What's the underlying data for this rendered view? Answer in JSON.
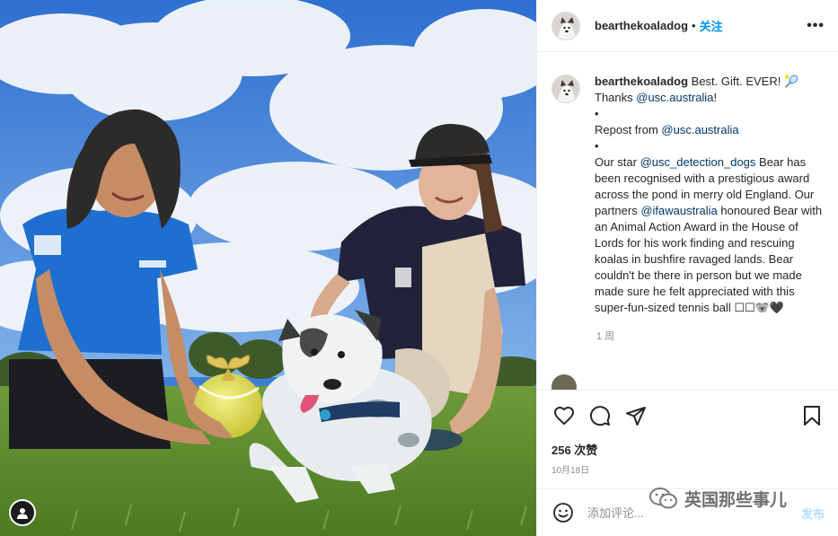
{
  "post": {
    "username": "bearthekoaladog",
    "follow_label": "关注",
    "header_separator": "•",
    "more_label": "•••",
    "caption": {
      "username": "bearthekoaladog",
      "line1": " Best. Gift. EVER! 🎾",
      "line2_prefix": "Thanks ",
      "line2_mention": "@usc.australia",
      "line2_suffix": "!",
      "bullet1": "•",
      "repost_prefix": "Repost from ",
      "repost_mention": "@usc.australia",
      "bullet2": "•",
      "body_prefix": "Our star ",
      "body_mention1": "@usc_detection_dogs",
      "body_mid1": " Bear has been recognised with a prestigious award across the pond in merry old England. Our partners ",
      "body_mention2": "@ifawaustralia",
      "body_mid2": " honoured Bear with an Animal Action Award in the House of Lords for his work finding and rescuing koalas in bushfire ravaged lands. Bear couldn't be there in person but we made made sure he felt appreciated with this super-fun-sized tennis ball ",
      "body_emoji": "☐☐🐨🖤"
    },
    "time_ago": "1 周",
    "likes": "256 次赞",
    "date": "10月18日"
  },
  "composer": {
    "placeholder": "添加评论...",
    "post_label": "发布"
  },
  "watermark": {
    "text": "英国那些事儿"
  },
  "icons": {
    "like": "heart-icon",
    "comment": "comment-icon",
    "share": "send-icon",
    "save": "bookmark-icon",
    "emoji": "smiley-icon",
    "more": "more-icon"
  },
  "colors": {
    "accent_blue": "#0095f6",
    "mention_blue": "#00376b",
    "muted_gray": "#8e8e8e",
    "post_button_disabled": "#b2dffc"
  }
}
